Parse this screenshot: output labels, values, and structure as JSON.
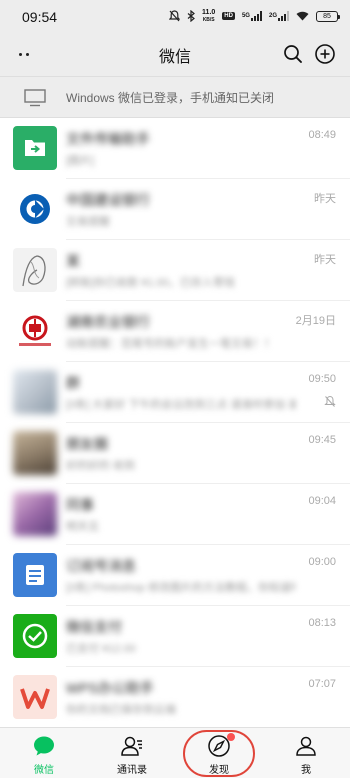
{
  "status_bar": {
    "time": "09:54",
    "net_speed_value": "11.0",
    "net_speed_unit": "KB/S",
    "hd_label": "HD",
    "signal1_label": "5G",
    "signal2_label": "2G",
    "battery": "85"
  },
  "header": {
    "title": "微信"
  },
  "notice": {
    "text": "Windows 微信已登录，手机通知已关闭"
  },
  "chats": [
    {
      "name": "文件传输助手",
      "message": "[图片]",
      "time": "08:49",
      "avatar": "folder-transfer",
      "color": "#2aae67",
      "muted": false
    },
    {
      "name": "中国建设银行",
      "message": "交易提醒",
      "time": "昨天",
      "avatar": "ccb-logo",
      "color": "#0a5fb4",
      "muted": false
    },
    {
      "name": "某",
      "message": "[转账]你已收款 ¥1.00，已存入零钱",
      "time": "昨天",
      "avatar": "sketch",
      "color": "#cccccc",
      "muted": false
    },
    {
      "name": "湖南农业银行",
      "message": "动账提醒：您尾号的账户发生一笔交易！！",
      "time": "2月19日",
      "avatar": "bank-red-logo",
      "color": "#c8161d",
      "muted": false
    },
    {
      "name": "群",
      "message": "[3条] 大家好 下午的会议改到三点 请准时参加 谢谢大家一下，还有一下…",
      "time": "09:50",
      "avatar": "group-photo",
      "color": "#b9c2cc",
      "muted": true
    },
    {
      "name": "朋友圈",
      "message": "好的好的 收到",
      "time": "09:45",
      "avatar": "person-photo",
      "color": "#8a7a66",
      "muted": false
    },
    {
      "name": "同事",
      "message": "明天见",
      "time": "09:04",
      "avatar": "girl-photo",
      "color": "#9b6aa8",
      "muted": false
    },
    {
      "name": "订阅号消息",
      "message": "[3条] Photoshop 修改图片的方法教程，你知道吗？[视频]",
      "time": "09:00",
      "avatar": "subscription",
      "color": "#3d7fd6",
      "muted": false
    },
    {
      "name": "微信支付",
      "message": "已支付 ¥12.00",
      "time": "08:13",
      "avatar": "wechat-pay",
      "color": "#1aad19",
      "muted": false
    },
    {
      "name": "WPS办公助手",
      "message": "你的文档已保存到云端",
      "time": "07:07",
      "avatar": "wps-logo",
      "color": "#e44b3a",
      "muted": false
    }
  ],
  "tabs": [
    {
      "label": "微信",
      "icon": "chat-bubble-icon",
      "active": true
    },
    {
      "label": "通讯录",
      "icon": "contacts-icon",
      "active": false
    },
    {
      "label": "发现",
      "icon": "compass-icon",
      "active": false,
      "badge": true
    },
    {
      "label": "我",
      "icon": "person-icon",
      "active": false
    }
  ],
  "colors": {
    "accent": "#07c160",
    "badge": "#fa5151",
    "highlight": "#e0453a",
    "background": "#ededed"
  }
}
